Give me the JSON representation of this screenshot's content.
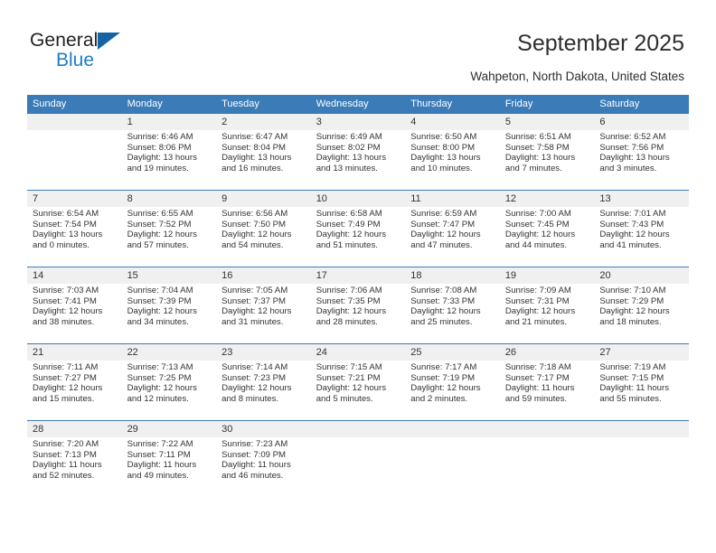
{
  "brand": {
    "name_part1": "General",
    "name_part2": "Blue",
    "triangle_color": "#1464a5",
    "blue_color": "#1f7ec4"
  },
  "header": {
    "title": "September 2025",
    "location": "Wahpeton, North Dakota, United States"
  },
  "theme": {
    "header_blue": "#3b7cb8",
    "numrow_gray": "#f0f0f0",
    "cell_white": "#ffffff",
    "text": "#333333"
  },
  "weekdays": [
    "Sunday",
    "Monday",
    "Tuesday",
    "Wednesday",
    "Thursday",
    "Friday",
    "Saturday"
  ],
  "weeks": [
    {
      "numbers": [
        "",
        "1",
        "2",
        "3",
        "4",
        "5",
        "6"
      ],
      "cells": [
        {
          "l1": "",
          "l2": "",
          "l3": "",
          "l4": ""
        },
        {
          "l1": "Sunrise: 6:46 AM",
          "l2": "Sunset: 8:06 PM",
          "l3": "Daylight: 13 hours",
          "l4": "and 19 minutes."
        },
        {
          "l1": "Sunrise: 6:47 AM",
          "l2": "Sunset: 8:04 PM",
          "l3": "Daylight: 13 hours",
          "l4": "and 16 minutes."
        },
        {
          "l1": "Sunrise: 6:49 AM",
          "l2": "Sunset: 8:02 PM",
          "l3": "Daylight: 13 hours",
          "l4": "and 13 minutes."
        },
        {
          "l1": "Sunrise: 6:50 AM",
          "l2": "Sunset: 8:00 PM",
          "l3": "Daylight: 13 hours",
          "l4": "and 10 minutes."
        },
        {
          "l1": "Sunrise: 6:51 AM",
          "l2": "Sunset: 7:58 PM",
          "l3": "Daylight: 13 hours",
          "l4": "and 7 minutes."
        },
        {
          "l1": "Sunrise: 6:52 AM",
          "l2": "Sunset: 7:56 PM",
          "l3": "Daylight: 13 hours",
          "l4": "and 3 minutes."
        }
      ]
    },
    {
      "numbers": [
        "7",
        "8",
        "9",
        "10",
        "11",
        "12",
        "13"
      ],
      "cells": [
        {
          "l1": "Sunrise: 6:54 AM",
          "l2": "Sunset: 7:54 PM",
          "l3": "Daylight: 13 hours",
          "l4": "and 0 minutes."
        },
        {
          "l1": "Sunrise: 6:55 AM",
          "l2": "Sunset: 7:52 PM",
          "l3": "Daylight: 12 hours",
          "l4": "and 57 minutes."
        },
        {
          "l1": "Sunrise: 6:56 AM",
          "l2": "Sunset: 7:50 PM",
          "l3": "Daylight: 12 hours",
          "l4": "and 54 minutes."
        },
        {
          "l1": "Sunrise: 6:58 AM",
          "l2": "Sunset: 7:49 PM",
          "l3": "Daylight: 12 hours",
          "l4": "and 51 minutes."
        },
        {
          "l1": "Sunrise: 6:59 AM",
          "l2": "Sunset: 7:47 PM",
          "l3": "Daylight: 12 hours",
          "l4": "and 47 minutes."
        },
        {
          "l1": "Sunrise: 7:00 AM",
          "l2": "Sunset: 7:45 PM",
          "l3": "Daylight: 12 hours",
          "l4": "and 44 minutes."
        },
        {
          "l1": "Sunrise: 7:01 AM",
          "l2": "Sunset: 7:43 PM",
          "l3": "Daylight: 12 hours",
          "l4": "and 41 minutes."
        }
      ]
    },
    {
      "numbers": [
        "14",
        "15",
        "16",
        "17",
        "18",
        "19",
        "20"
      ],
      "cells": [
        {
          "l1": "Sunrise: 7:03 AM",
          "l2": "Sunset: 7:41 PM",
          "l3": "Daylight: 12 hours",
          "l4": "and 38 minutes."
        },
        {
          "l1": "Sunrise: 7:04 AM",
          "l2": "Sunset: 7:39 PM",
          "l3": "Daylight: 12 hours",
          "l4": "and 34 minutes."
        },
        {
          "l1": "Sunrise: 7:05 AM",
          "l2": "Sunset: 7:37 PM",
          "l3": "Daylight: 12 hours",
          "l4": "and 31 minutes."
        },
        {
          "l1": "Sunrise: 7:06 AM",
          "l2": "Sunset: 7:35 PM",
          "l3": "Daylight: 12 hours",
          "l4": "and 28 minutes."
        },
        {
          "l1": "Sunrise: 7:08 AM",
          "l2": "Sunset: 7:33 PM",
          "l3": "Daylight: 12 hours",
          "l4": "and 25 minutes."
        },
        {
          "l1": "Sunrise: 7:09 AM",
          "l2": "Sunset: 7:31 PM",
          "l3": "Daylight: 12 hours",
          "l4": "and 21 minutes."
        },
        {
          "l1": "Sunrise: 7:10 AM",
          "l2": "Sunset: 7:29 PM",
          "l3": "Daylight: 12 hours",
          "l4": "and 18 minutes."
        }
      ]
    },
    {
      "numbers": [
        "21",
        "22",
        "23",
        "24",
        "25",
        "26",
        "27"
      ],
      "cells": [
        {
          "l1": "Sunrise: 7:11 AM",
          "l2": "Sunset: 7:27 PM",
          "l3": "Daylight: 12 hours",
          "l4": "and 15 minutes."
        },
        {
          "l1": "Sunrise: 7:13 AM",
          "l2": "Sunset: 7:25 PM",
          "l3": "Daylight: 12 hours",
          "l4": "and 12 minutes."
        },
        {
          "l1": "Sunrise: 7:14 AM",
          "l2": "Sunset: 7:23 PM",
          "l3": "Daylight: 12 hours",
          "l4": "and 8 minutes."
        },
        {
          "l1": "Sunrise: 7:15 AM",
          "l2": "Sunset: 7:21 PM",
          "l3": "Daylight: 12 hours",
          "l4": "and 5 minutes."
        },
        {
          "l1": "Sunrise: 7:17 AM",
          "l2": "Sunset: 7:19 PM",
          "l3": "Daylight: 12 hours",
          "l4": "and 2 minutes."
        },
        {
          "l1": "Sunrise: 7:18 AM",
          "l2": "Sunset: 7:17 PM",
          "l3": "Daylight: 11 hours",
          "l4": "and 59 minutes."
        },
        {
          "l1": "Sunrise: 7:19 AM",
          "l2": "Sunset: 7:15 PM",
          "l3": "Daylight: 11 hours",
          "l4": "and 55 minutes."
        }
      ]
    },
    {
      "numbers": [
        "28",
        "29",
        "30",
        "",
        "",
        "",
        ""
      ],
      "cells": [
        {
          "l1": "Sunrise: 7:20 AM",
          "l2": "Sunset: 7:13 PM",
          "l3": "Daylight: 11 hours",
          "l4": "and 52 minutes."
        },
        {
          "l1": "Sunrise: 7:22 AM",
          "l2": "Sunset: 7:11 PM",
          "l3": "Daylight: 11 hours",
          "l4": "and 49 minutes."
        },
        {
          "l1": "Sunrise: 7:23 AM",
          "l2": "Sunset: 7:09 PM",
          "l3": "Daylight: 11 hours",
          "l4": "and 46 minutes."
        },
        {
          "l1": "",
          "l2": "",
          "l3": "",
          "l4": ""
        },
        {
          "l1": "",
          "l2": "",
          "l3": "",
          "l4": ""
        },
        {
          "l1": "",
          "l2": "",
          "l3": "",
          "l4": ""
        },
        {
          "l1": "",
          "l2": "",
          "l3": "",
          "l4": ""
        }
      ]
    }
  ]
}
